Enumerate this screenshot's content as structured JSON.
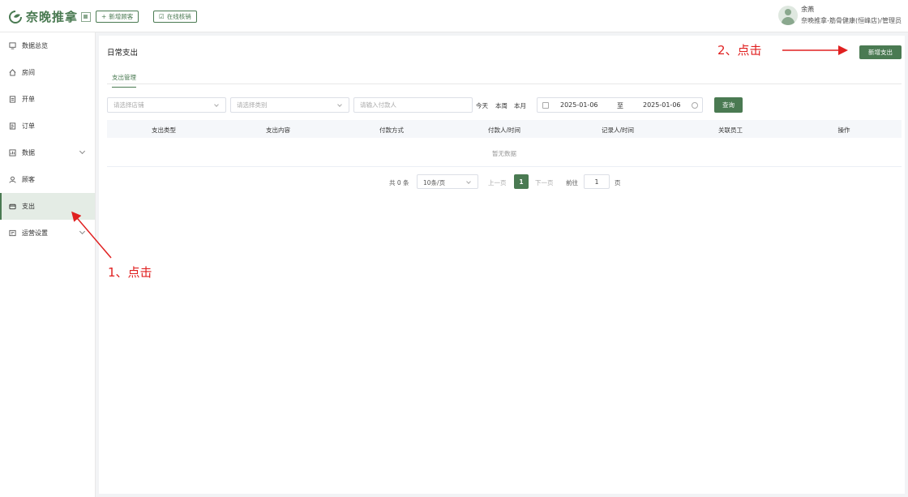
{
  "header": {
    "brand": "奈晚推拿",
    "add_customer": "新增顾客",
    "online_writeoff": "在线核销",
    "user_name": "余燕",
    "user_org": "奈晚推拿-筋骨健康(恒峰店)/管理员"
  },
  "sidebar": {
    "items": [
      {
        "label": "数据总览",
        "icon": "monitor-icon"
      },
      {
        "label": "房间",
        "icon": "home-icon"
      },
      {
        "label": "开单",
        "icon": "document-icon"
      },
      {
        "label": "订单",
        "icon": "order-icon"
      },
      {
        "label": "数据",
        "icon": "chart-icon"
      },
      {
        "label": "顾客",
        "icon": "user-icon"
      },
      {
        "label": "支出",
        "icon": "wallet-icon"
      },
      {
        "label": "运营设置",
        "icon": "settings-icon"
      }
    ]
  },
  "main": {
    "title": "日常支出",
    "add_button": "新增支出",
    "tab": "支出管理",
    "filters": {
      "store_placeholder": "请选择店铺",
      "category_placeholder": "请选择类别",
      "payer_placeholder": "请输入付款人",
      "today": "今天",
      "this_week": "本周",
      "this_month": "本月",
      "date_start": "2025-01-06",
      "date_sep": "至",
      "date_end": "2025-01-06",
      "search": "查询"
    },
    "table": {
      "columns": [
        "支出类型",
        "支出内容",
        "付款方式",
        "付款人/时间",
        "记录人/时间",
        "关联员工",
        "操作"
      ],
      "empty": "暂无数据"
    },
    "pagination": {
      "total": "共 0 条",
      "page_size": "10条/页",
      "prev": "上一页",
      "current": "1",
      "next": "下一页",
      "goto": "前往",
      "goto_value": "1",
      "unit": "页"
    }
  },
  "annotations": {
    "step1": "1、点击",
    "step2": "2、点击",
    "color": "#e02020"
  },
  "colors": {
    "accent": "#4a7a52"
  }
}
